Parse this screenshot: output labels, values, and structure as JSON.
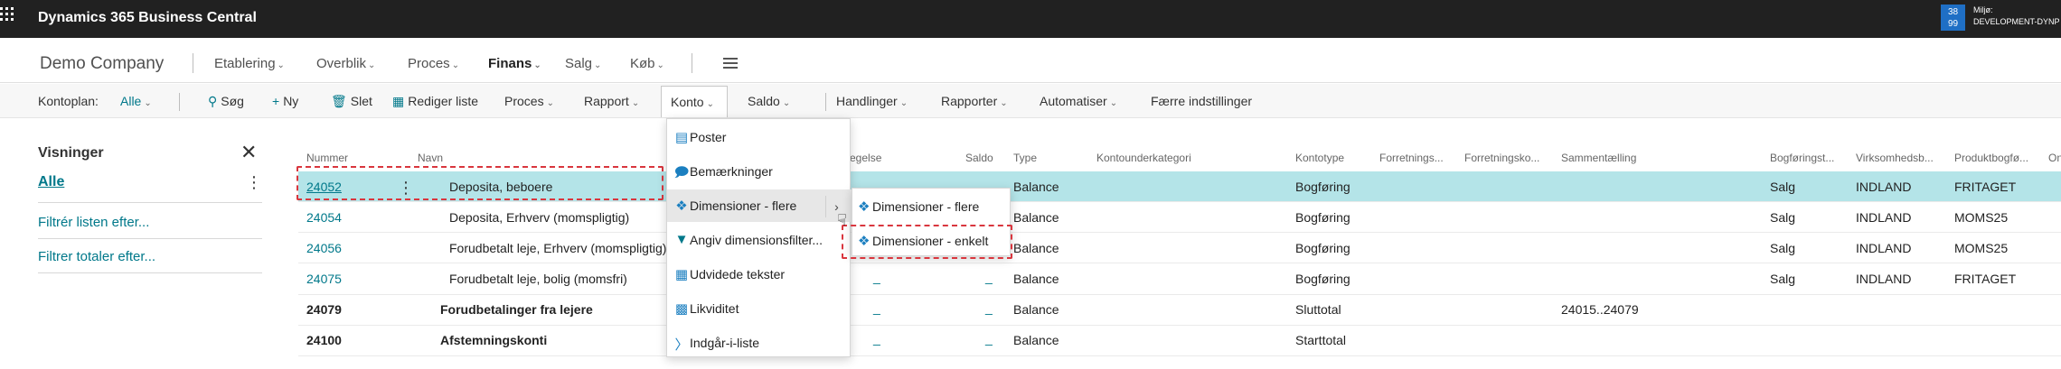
{
  "app": {
    "title": "Dynamics 365 Business Central",
    "env_badge_top": "38",
    "env_badge_bottom": "99",
    "env_label_line1": "Miljø:",
    "env_label_line2": "DEVELOPMENT-DYNP"
  },
  "nav": {
    "company": "Demo Company",
    "items": [
      "Etablering",
      "Overblik",
      "Proces",
      "Finans",
      "Salg",
      "Køb"
    ]
  },
  "actions": {
    "kontoplan_label": "Kontoplan:",
    "kontoplan_value": "Alle",
    "search": "Søg",
    "new": "Ny",
    "delete": "Slet",
    "edit_list": "Rediger liste",
    "process": "Proces",
    "report": "Rapport",
    "konto": "Konto",
    "saldo": "Saldo",
    "handlinger": "Handlinger",
    "rapporter": "Rapporter",
    "automatiser": "Automatiser",
    "fewer": "Færre indstillinger"
  },
  "pane": {
    "title": "Visninger",
    "alle": "Alle",
    "filter_list": "Filtrér listen efter...",
    "filter_totals": "Filtrer totaler efter..."
  },
  "grid": {
    "headers": [
      "Nummer",
      "Navn",
      "egelse",
      "Saldo",
      "Type",
      "Kontounderkategori",
      "Kontotype",
      "Forretnings...",
      "Forretningsko...",
      "Sammentælling",
      "Bogføringst...",
      "Virksomhedsb...",
      "Produktbogfø...",
      "On"
    ],
    "rows": [
      {
        "num": "24052",
        "name": "Deposita, beboere",
        "type": "Balance",
        "kontotype": "Bogføring",
        "sum": "",
        "bog": "Salg",
        "virk": "INDLAND",
        "prod": "FRITAGET"
      },
      {
        "num": "24054",
        "name": "Deposita, Erhverv (momspligtig)",
        "type": "Balance",
        "kontotype": "Bogføring",
        "sum": "",
        "bog": "Salg",
        "virk": "INDLAND",
        "prod": "MOMS25"
      },
      {
        "num": "24056",
        "name": "Forudbetalt leje, Erhverv (momspligtig)",
        "type": "Balance",
        "kontotype": "Bogføring",
        "sum": "",
        "bog": "Salg",
        "virk": "INDLAND",
        "prod": "MOMS25"
      },
      {
        "num": "24075",
        "name": "Forudbetalt leje, bolig (momsfri)",
        "type": "Balance",
        "kontotype": "Bogføring",
        "sum": "",
        "bog": "Salg",
        "virk": "INDLAND",
        "prod": "FRITAGET"
      },
      {
        "num": "24079",
        "name": "Forudbetalinger fra lejere",
        "type": "Balance",
        "kontotype": "Sluttotal",
        "sum": "24015..24079",
        "bog": "",
        "virk": "",
        "prod": ""
      },
      {
        "num": "24100",
        "name": "Afstemningskonti",
        "type": "Balance",
        "kontotype": "Starttotal",
        "sum": "",
        "bog": "",
        "virk": "",
        "prod": ""
      }
    ],
    "dash": "_"
  },
  "menu": {
    "items": [
      {
        "label": "Poster",
        "icon": "ledger-entries-icon"
      },
      {
        "label": "Bemærkninger",
        "icon": "comments-icon"
      },
      {
        "label": "Dimensioner - flere",
        "icon": "dimensions-icon"
      },
      {
        "label": "Angiv dimensionsfilter...",
        "icon": "filter-icon"
      },
      {
        "label": "Udvidede tekster",
        "icon": "extended-text-icon"
      },
      {
        "label": "Likviditet",
        "icon": "liquidity-icon"
      },
      {
        "label": "Indgår-i-liste",
        "icon": "where-used-icon"
      }
    ],
    "submenu": [
      {
        "label": "Dimensioner - flere",
        "icon": "dimensions-icon"
      },
      {
        "label": "Dimensioner - enkelt",
        "icon": "dimension-icon"
      }
    ]
  }
}
